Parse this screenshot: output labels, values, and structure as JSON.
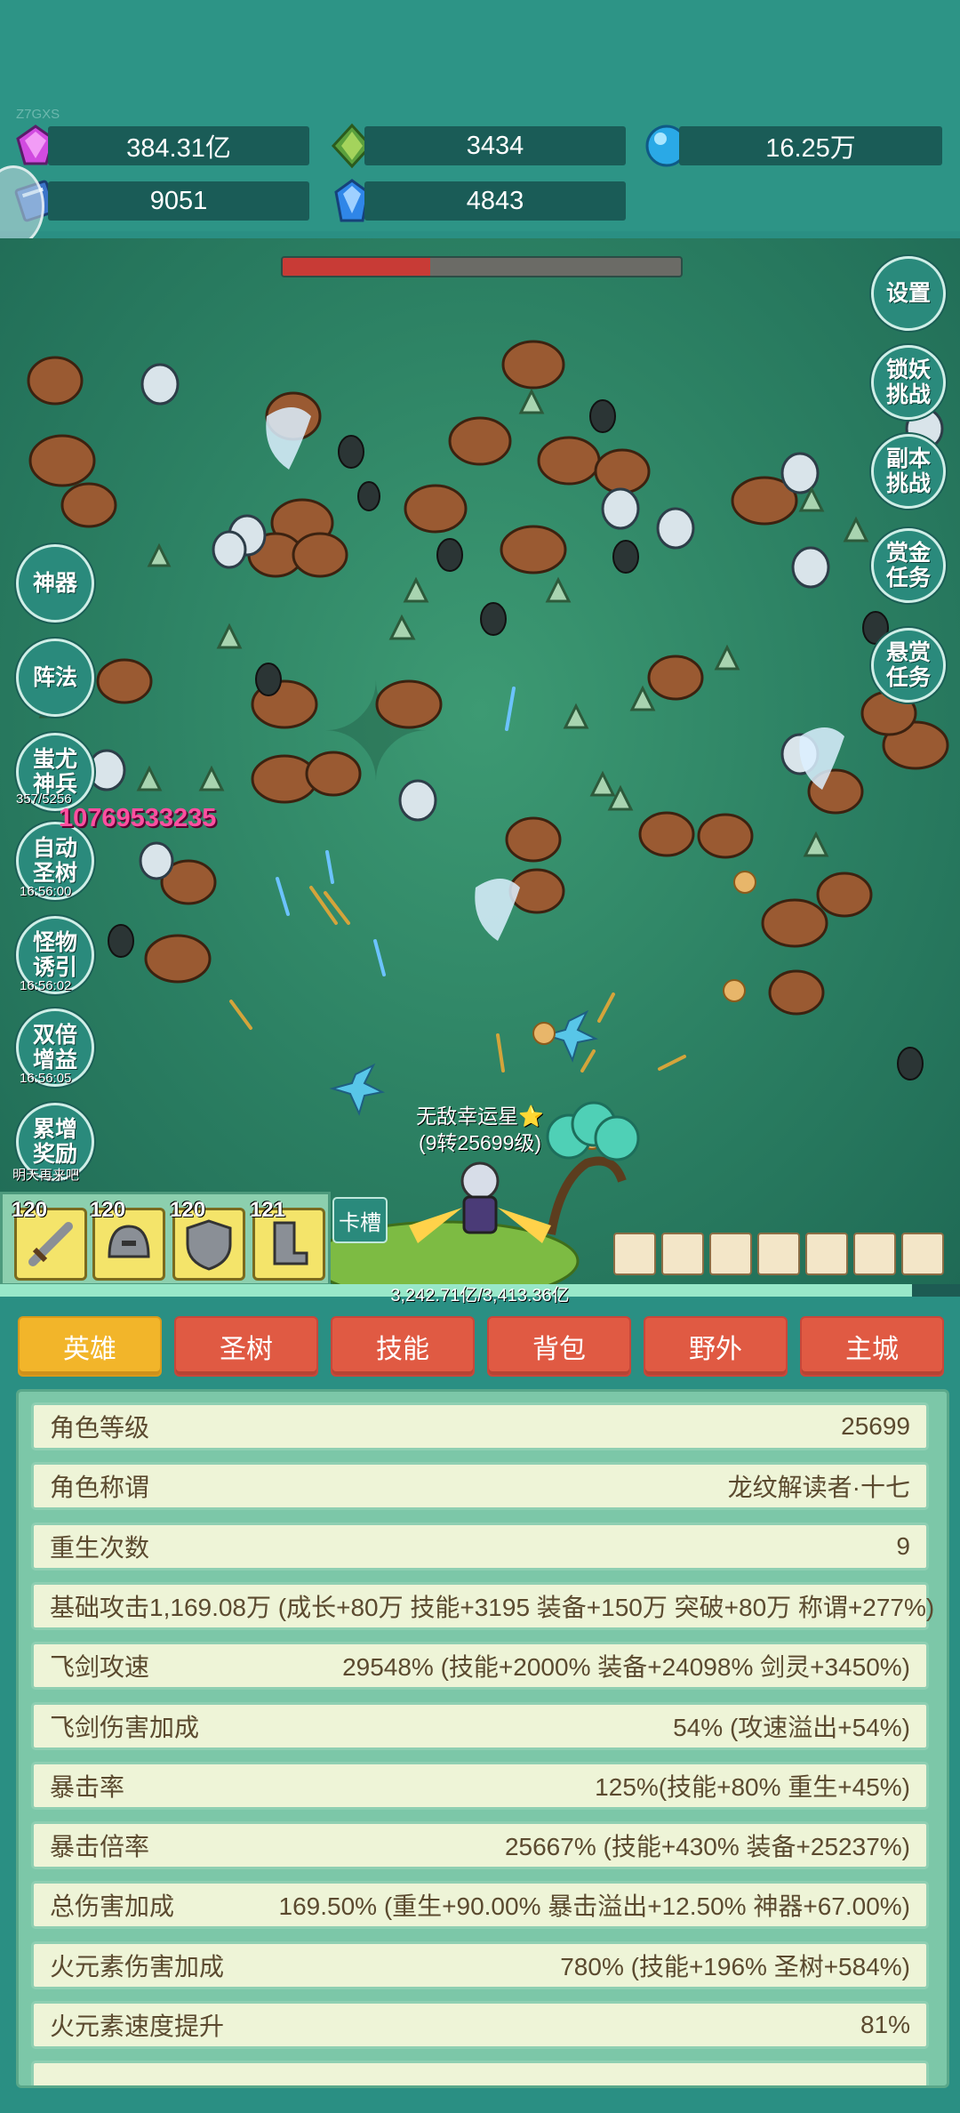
{
  "watermark": "Z7GXS",
  "resources": [
    {
      "icon": "purple-gem-icon",
      "value": "384.31亿"
    },
    {
      "icon": "green-crystal-icon",
      "value": "3434"
    },
    {
      "icon": "blue-orb-icon",
      "value": "16.25万"
    },
    {
      "icon": "book-icon",
      "value": "9051"
    },
    {
      "icon": "blue-crystal-icon",
      "value": "4843"
    }
  ],
  "boss_hp_fraction": 0.37,
  "right_buttons": {
    "settings": "设置",
    "lock_demon": "锁妖\n挑战",
    "dungeon": "副本\n挑战",
    "bounty_task": "赏金\n任务",
    "reward_task": "悬赏\n任务"
  },
  "left_buttons": {
    "artifact": "神器",
    "formation": "阵法",
    "chiyou": "蚩尤\n神兵",
    "chiyou_sub": "357/5256",
    "auto_tree": "自动\n圣树",
    "auto_tree_time": "16:56:00",
    "monster_lure": "怪物\n诱引",
    "monster_lure_time": "16:56:02",
    "double_gain": "双倍\n增益",
    "double_gain_time": "16:56:05",
    "accum_reward": "累增\n奖励",
    "accum_reward_sub": "明天再来吧"
  },
  "damage_number": "10769533235",
  "player": {
    "name": "无敌幸运星⭐",
    "level": "(9转25699级)"
  },
  "equipment": [
    {
      "icon": "sword-icon",
      "level": "120"
    },
    {
      "icon": "helmet-icon",
      "level": "120"
    },
    {
      "icon": "shield-icon",
      "level": "120"
    },
    {
      "icon": "boots-icon",
      "level": "121"
    }
  ],
  "card_slot_label": "卡槽",
  "hp_text": "3,242.71亿/3,413.36亿",
  "hp_fraction": 0.95,
  "tabs": [
    "英雄",
    "圣树",
    "技能",
    "背包",
    "野外",
    "主城"
  ],
  "active_tab": 0,
  "stats": [
    {
      "label": "角色等级",
      "value": "25699"
    },
    {
      "label": "角色称谓",
      "value": "龙纹解读者·十七"
    },
    {
      "label": "重生次数",
      "value": "9"
    },
    {
      "label": "基础攻击",
      "value": "1,169.08万 (成长+80万 技能+3195 装备+150万 突破+80万 称谓+277%)"
    },
    {
      "label": "飞剑攻速",
      "value": "29548% (技能+2000% 装备+24098% 剑灵+3450%)"
    },
    {
      "label": "飞剑伤害加成",
      "value": "54% (攻速溢出+54%)"
    },
    {
      "label": "暴击率",
      "value": "125%(技能+80% 重生+45%)"
    },
    {
      "label": "暴击倍率",
      "value": "25667% (技能+430% 装备+25237%)"
    },
    {
      "label": "总伤害加成",
      "value": "169.50% (重生+90.00% 暴击溢出+12.50% 神器+67.00%)"
    },
    {
      "label": "火元素伤害加成",
      "value": "780% (技能+196% 圣树+584%)"
    },
    {
      "label": "火元素速度提升",
      "value": "81%"
    }
  ]
}
